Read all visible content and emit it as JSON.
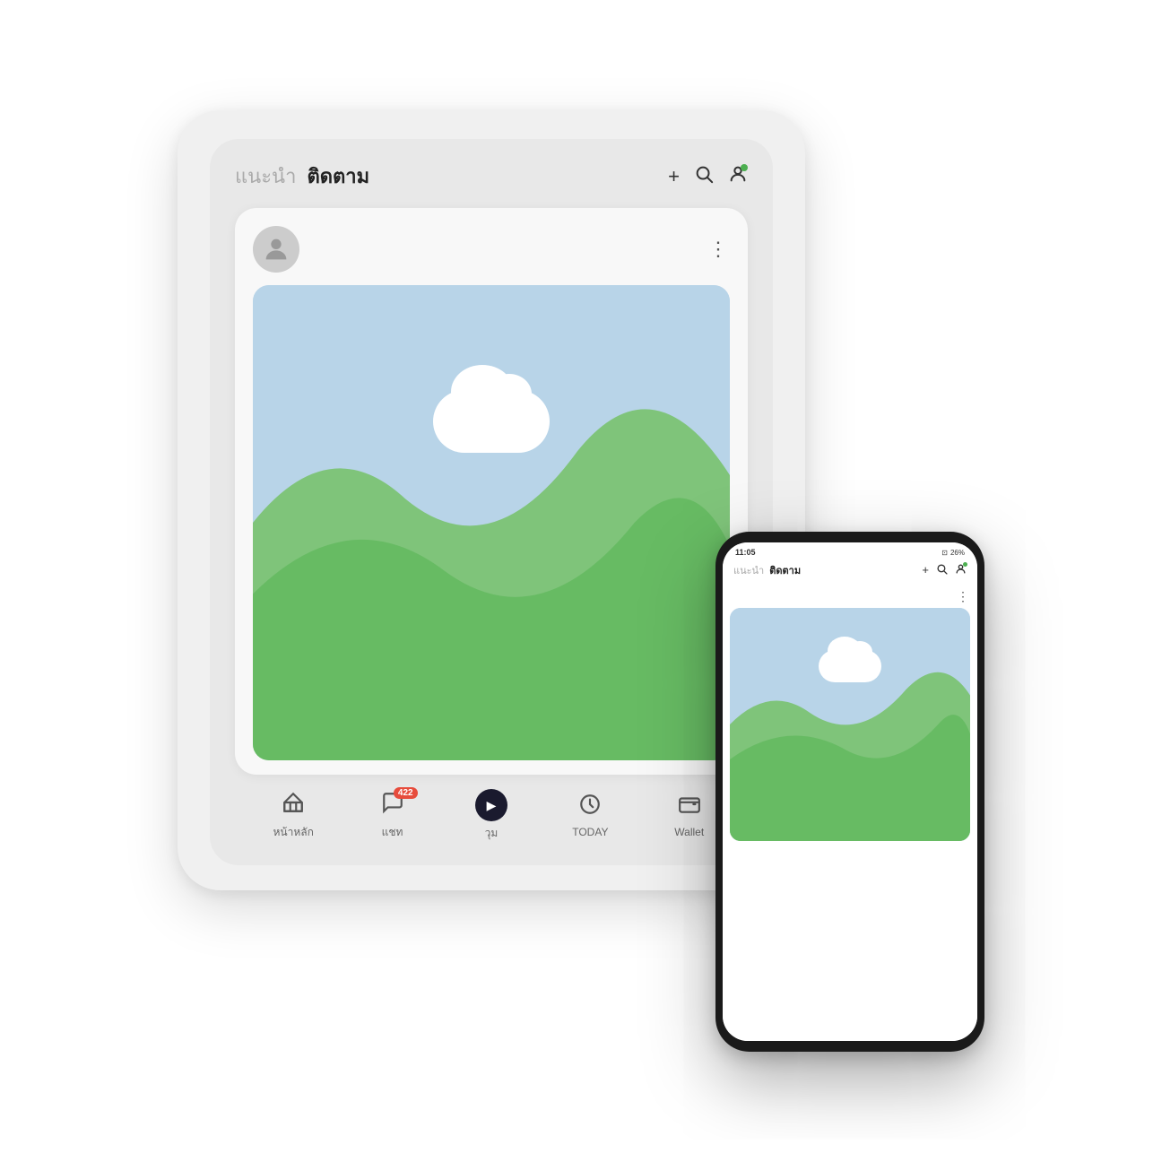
{
  "header": {
    "tab_suggest": "แนะนำ",
    "tab_follow": "ติดตาม",
    "add_icon": "+",
    "search_icon": "🔍",
    "profile_icon": "👤"
  },
  "post": {
    "more_icon": "⋮"
  },
  "bottom_nav": {
    "home_label": "หน้าหลัก",
    "chat_label": "แชท",
    "chat_badge": "422",
    "vum_label": "วุม",
    "today_label": "TODAY",
    "wallet_label": "Wallet"
  },
  "phone": {
    "status_time": "11:05",
    "status_battery": "26%",
    "tab_suggest": "แนะนำ",
    "tab_follow": "ติดตาม"
  }
}
